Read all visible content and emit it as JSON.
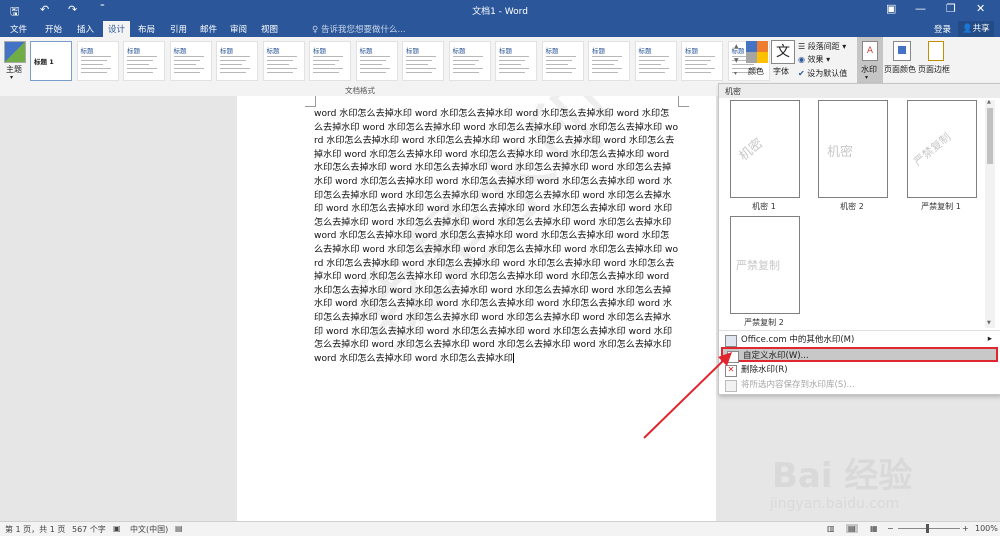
{
  "window": {
    "title": "文档1 - Word",
    "tabs": [
      "文件",
      "开始",
      "插入",
      "设计",
      "布局",
      "引用",
      "邮件",
      "审阅",
      "视图"
    ],
    "active_tab": "设计",
    "tell_me_placeholder": "告诉我您想要做什么...",
    "sign_in": "登录",
    "share": "共享",
    "quick_access_mark": "⁼"
  },
  "ribbon": {
    "theme_label": "主题",
    "gallery_titles": [
      "标题 1",
      "标题",
      "标题",
      "标题",
      "标题",
      "标题",
      "标题",
      "标题",
      "标题",
      "标题",
      "标题",
      "标题",
      "标题",
      "标题",
      "标题",
      "标题"
    ],
    "group_label": "文档格式",
    "colors_label": "颜色",
    "fonts_label": "字体",
    "paragraph_spacing": "段落间距",
    "effects": "效果",
    "set_default": "设为默认值",
    "watermark": "水印",
    "page_color": "页面颜色",
    "page_border": "页面边框"
  },
  "document": {
    "text": "word 水印怎么去掉水印 word 水印怎么去掉水印 word 水印怎么去掉水印 word 水印怎么去掉水印 word 水印怎么去掉水印 word 水印怎么去掉水印 word 水印怎么去掉水印 word 水印怎么去掉水印 word 水印怎么去掉水印 word 水印怎么去掉水印 word 水印怎么去掉水印 word 水印怎么去掉水印 word 水印怎么去掉水印 word 水印怎么去掉水印 word 水印怎么去掉水印 word 水印怎么去掉水印 word 水印怎么去掉水印 word 水印怎么去掉水印 word 水印怎么去掉水印 word 水印怎么去掉水印 word 水印怎么去掉水印 word 水印怎么去掉水印 word 水印怎么去掉水印 word 水印怎么去掉水印 word 水印怎么去掉水印 word 水印怎么去掉水印 word 水印怎么去掉水印 word 水印怎么去掉水印 word 水印怎么去掉水印 word 水印怎么去掉水印 word 水印怎么去掉水印 word 水印怎么去掉水印 word 水印怎么去掉水印 word 水印怎么去掉水印 word 水印怎么去掉水印 word 水印怎么去掉水印 word 水印怎么去掉水印 word 水印怎么去掉水印 word 水印怎么去掉水印 word 水印怎么去掉水印 word 水印怎么去掉水印 word 水印怎么去掉水印 word 水印怎么去掉水印 word 水印怎么去掉水印 word 水印怎么去掉水印 word 水印怎么去掉水印 word 水印怎么去掉水印 word 水印怎么去掉水印 word 水印怎么去掉水印 word 水印怎么去掉水印 word 水印怎么去掉水印 word 水印怎么去掉水印 word 水印怎么去掉水印 word 水印怎么去掉水印 word 水印怎么去掉水印 word 水印怎么去掉水印 word 水印怎么去掉水印 word 水印怎么去掉水印 word 水印怎么去掉水印 word 水印怎么去掉水印 word 水印怎么去掉水印 word 水印怎么去掉水印 word 水印怎么去掉水印 word 水印怎么去掉水印 word 水印怎么去掉水印 word 水印怎么去掉水印",
    "watermark_text": "我是水印"
  },
  "watermark_panel": {
    "header": "机密",
    "items": [
      {
        "preview": "机密",
        "caption": "机密 1"
      },
      {
        "preview": "机密",
        "caption": "机密 2"
      },
      {
        "preview": "严禁复制",
        "caption": "严禁复制 1"
      },
      {
        "preview": "严禁复制",
        "caption": "严禁复制 2"
      }
    ],
    "more_from_office": "Office.com 中的其他水印(M)",
    "custom": "自定义水印(W)...",
    "remove": "删除水印(R)",
    "save_selection": "将所选内容保存到水印库(S)..."
  },
  "status": {
    "page": "第 1 页，共 1 页",
    "words": "567 个字",
    "language": "中文(中国)",
    "zoom": "100%"
  },
  "overlay": {
    "brand": "Bai 经验",
    "url": "jingyan.baidu.com"
  },
  "colors": {
    "accent": "#2b579a",
    "highlight_border": "#e0262e",
    "arrow": "#e0262e"
  }
}
